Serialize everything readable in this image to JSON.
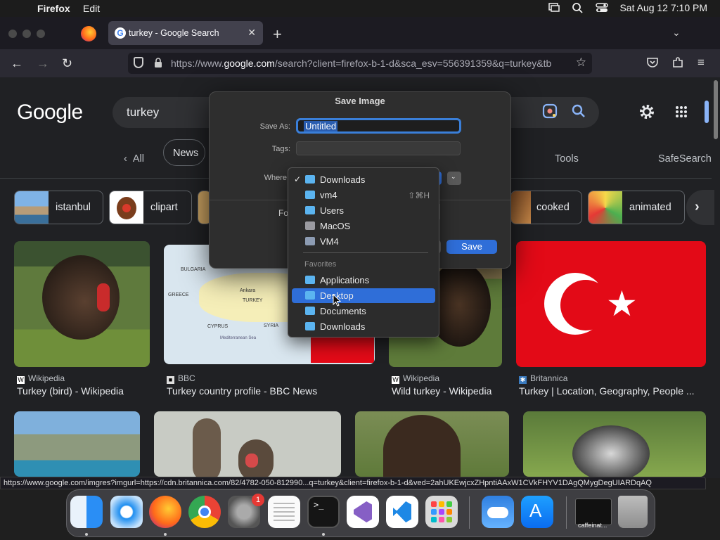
{
  "menubar": {
    "app": "Firefox",
    "items": [
      "Edit"
    ],
    "datetime": "Sat Aug 12  7:10 PM"
  },
  "browser": {
    "tab_title": "turkey - Google Search",
    "url_prefix": "https://www.",
    "url_domain": "google.com",
    "url_rest": "/search?client=firefox-b-1-d&sca_esv=556391359&q=turkey&tb"
  },
  "google": {
    "logo": "Google",
    "query": "turkey",
    "filters": {
      "all": "All",
      "news": "News",
      "tools": "Tools",
      "safesearch": "SafeSearch"
    },
    "chips": [
      "istanbul",
      "clipart",
      "cooked",
      "animated"
    ],
    "results": [
      {
        "source": "Wikipedia",
        "title": "Turkey (bird) - Wikipedia"
      },
      {
        "source": "BBC",
        "title": "Turkey country profile - BBC News"
      },
      {
        "source": "Wikipedia",
        "title": "Wild turkey - Wikipedia"
      },
      {
        "source": "Britannica",
        "title": "Turkey | Location, Geography, People ..."
      }
    ],
    "map_labels": {
      "bulgaria": "BULGARIA",
      "greece": "GREECE",
      "ankara": "Ankara",
      "turkey": "TURKEY",
      "cyprus": "CYPRUS",
      "syria": "SYRIA",
      "sea": "Mediterranean Sea"
    }
  },
  "status_url": "https://www.google.com/imgres?imgurl=https://cdn.britannica.com/82/4782-050-812990...q=turkey&client=firefox-b-1-d&ved=2ahUKEwjcxZHpntiAAxW1CVkFHYV1DAgQMygDegUIARDqAQ",
  "dialog": {
    "title": "Save Image",
    "save_as_label": "Save As:",
    "save_as_value": "Untitled",
    "tags_label": "Tags:",
    "where_label": "Where",
    "format_label": "Fo",
    "save_label": "Save"
  },
  "where_menu": {
    "selected": "Downloads",
    "items": [
      {
        "label": "Downloads",
        "checked": true
      },
      {
        "label": "vm4",
        "shortcut": "⇧⌘H"
      },
      {
        "label": "Users"
      },
      {
        "label": "MacOS"
      },
      {
        "label": "VM4"
      }
    ],
    "favorites_header": "Favorites",
    "favorites": [
      "Applications",
      "Desktop",
      "Documents",
      "Downloads"
    ],
    "highlighted": "Desktop"
  },
  "dock": {
    "settings_badge": "1",
    "caffeinate_label": "caffeinat..."
  },
  "colors": {
    "accent": "#2f6ed8",
    "google_blue": "#8ab4f8",
    "flag_red": "#e30a17"
  }
}
